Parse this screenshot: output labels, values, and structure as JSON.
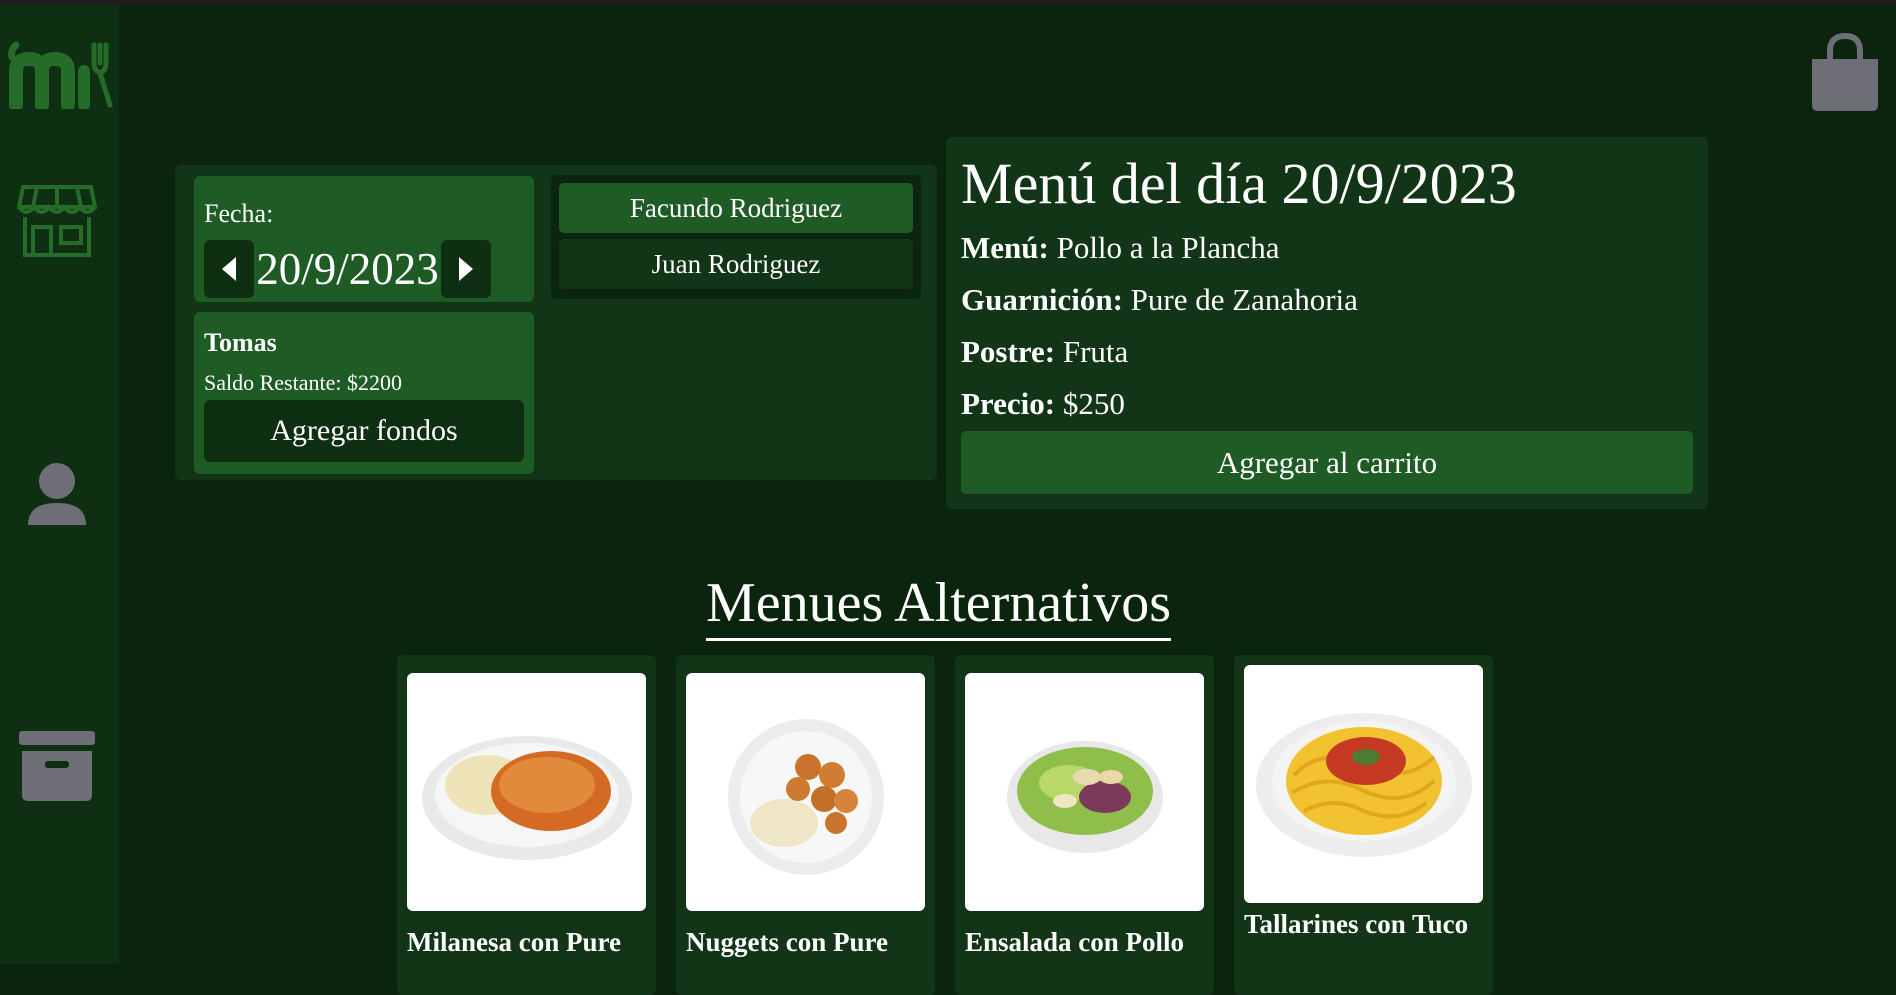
{
  "date_picker": {
    "label": "Fecha:",
    "value": "20/9/2023"
  },
  "users": [
    {
      "name": "Facundo Rodriguez",
      "selected": true
    },
    {
      "name": "Juan Rodriguez",
      "selected": false
    }
  ],
  "current_user": {
    "name": "Tomas",
    "balance_text": "Saldo Restante: $2200",
    "add_funds_label": "Agregar fondos"
  },
  "menu_of_day": {
    "title": "Menú del día 20/9/2023",
    "menu_label": "Menú:",
    "menu_value": "Pollo a la Plancha",
    "side_label": "Guarnición:",
    "side_value": "Pure de Zanahoria",
    "dessert_label": "Postre:",
    "dessert_value": "Fruta",
    "price_label": "Precio:",
    "price_value": "$250",
    "add_to_cart_label": "Agregar al carrito"
  },
  "alternatives": {
    "title": "Menues Alternativos",
    "items": [
      {
        "name": "Milanesa con Pure"
      },
      {
        "name": "Nuggets con Pure"
      },
      {
        "name": "Ensalada con Pollo"
      },
      {
        "name": "Tallarines con Tuco"
      }
    ]
  },
  "icons": {
    "logo": "logo-icon",
    "store": "store-icon",
    "user": "user-icon",
    "archive": "archive-icon",
    "bag": "shopping-bag-icon"
  },
  "colors": {
    "background": "#0b240d",
    "sidebar": "#0f2f13",
    "panel": "#113516",
    "accent": "#1f5b24",
    "icon_gray": "#6e6e76"
  }
}
